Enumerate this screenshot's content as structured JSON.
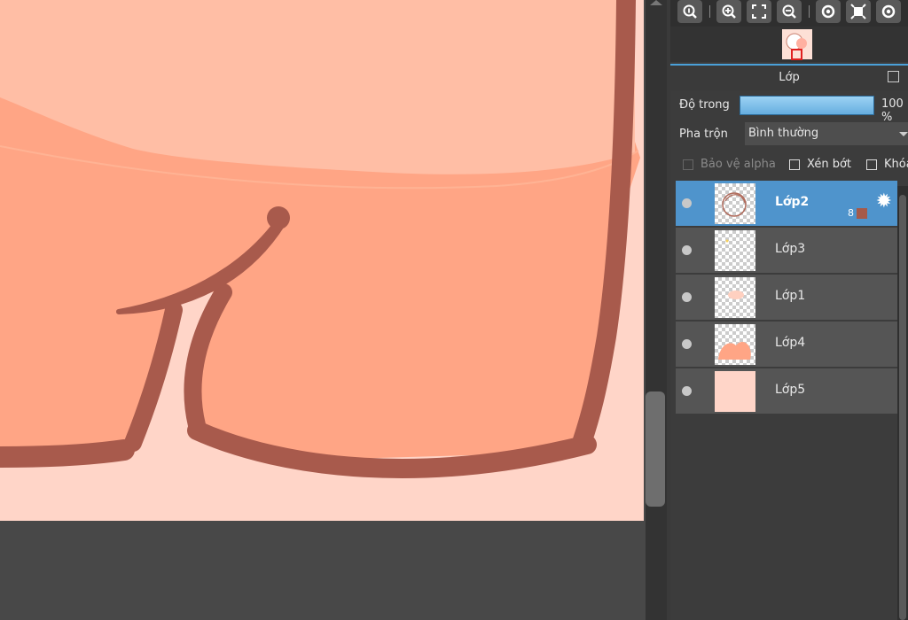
{
  "toolbar": {
    "buttons": [
      "zoom-actual-icon",
      "zoom-in-icon",
      "fit-screen-icon",
      "zoom-out-icon",
      "rotate-left-icon",
      "fit-window-icon",
      "rotate-right-icon"
    ]
  },
  "layer_panel": {
    "title": "Lớp",
    "opacity_label": "Độ trong",
    "opacity_value": "100 %",
    "opacity_fraction": 1.0,
    "blend_label": "Pha trộn",
    "blend_value": "Bình thường",
    "protect_alpha_label": "Bảo vệ alpha",
    "clip_label": "Xén bớt",
    "lock_label": "Khóa",
    "layers": [
      {
        "name": "Lớp2",
        "selected": true,
        "badge": "8",
        "swatch_color": "#a55a4a"
      },
      {
        "name": "Lớp3",
        "selected": false
      },
      {
        "name": "Lớp1",
        "selected": false
      },
      {
        "name": "Lớp4",
        "selected": false
      },
      {
        "name": "Lớp5",
        "selected": false
      }
    ]
  },
  "colors": {
    "accent": "#4f94cc",
    "skin_light": "#ffbea5",
    "skin_mid": "#ffa585",
    "skin_pale": "#ffd5c8",
    "line": "#a85a4c",
    "workspace": "#484848"
  }
}
